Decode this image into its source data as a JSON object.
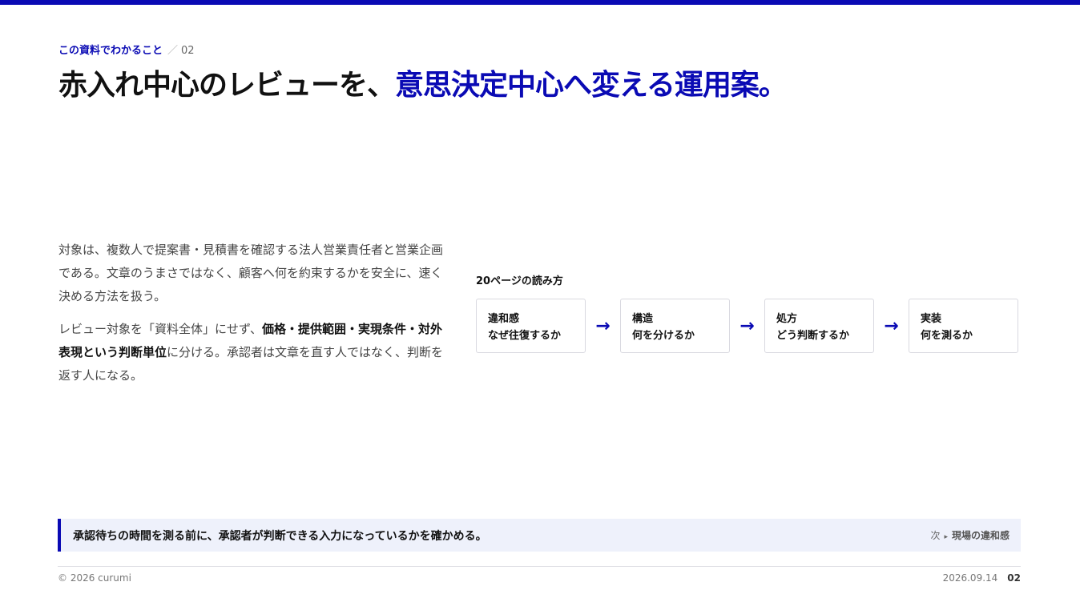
{
  "header": {
    "eyebrow": "この資料でわかること",
    "eyebrow_separator": "／",
    "page_number": "02",
    "title_main": "赤入れ中心のレビューを、",
    "title_accent": "意思決定中心へ変える運用案。"
  },
  "intro": {
    "paragraph1": "対象は、複数人で提案書・見積書を確認する法人営業責任者と営業企画である。文章のうまさではなく、顧客へ何を約束するかを安全に、速く決める方法を扱う。",
    "paragraph2_before": "レビュー対象を「資料全体」にせず、",
    "paragraph2_bold": "価格・提供範囲・実現条件・対外表現という判断単位",
    "paragraph2_after": "に分ける。承認者は文章を直す人ではなく、判断を返す人になる。"
  },
  "flow": {
    "label": "20ページの読み方",
    "steps": [
      {
        "title": "違和感",
        "subtitle": "なぜ往復するか"
      },
      {
        "title": "構造",
        "subtitle": "何を分けるか"
      },
      {
        "title": "処方",
        "subtitle": "どう判断するか"
      },
      {
        "title": "実装",
        "subtitle": "何を測るか"
      }
    ],
    "arrow": "→"
  },
  "callout": {
    "text": "承認待ちの時間を測る前に、承認者が判断できる入力になっているかを確かめる。",
    "next_label": "次",
    "next_marker": "▸",
    "next_target": "現場の違和感"
  },
  "footer": {
    "copyright": "© 2026 curumi",
    "date": "2026.09.14",
    "page": "02"
  },
  "colors": {
    "accent": "#0a0ab4",
    "callout_bg": "#eef1fb"
  }
}
